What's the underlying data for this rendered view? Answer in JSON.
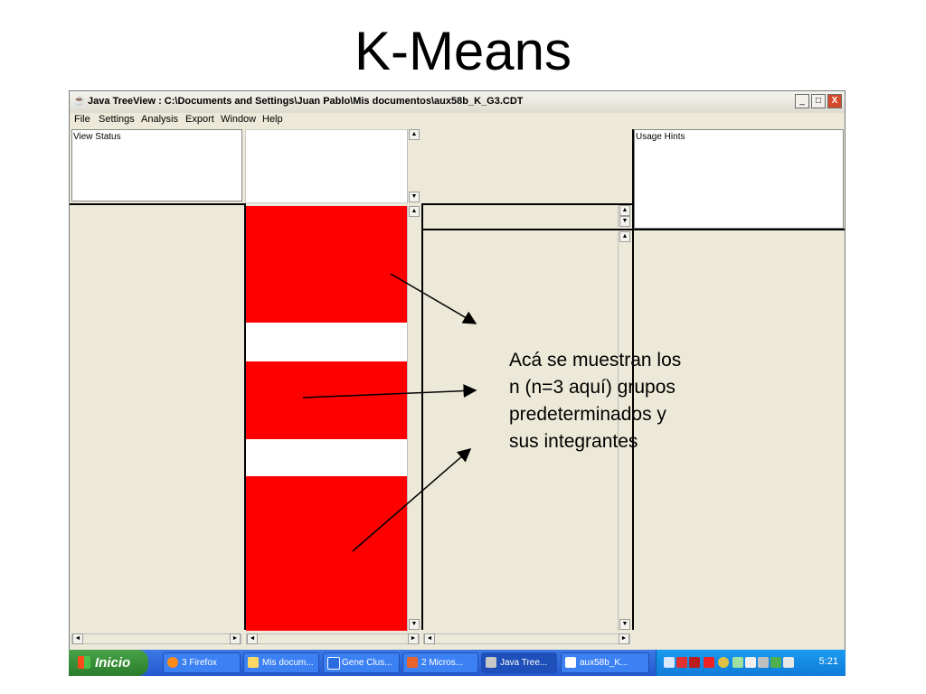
{
  "slide": {
    "title": "K-Means"
  },
  "window": {
    "title": "Java TreeView : C:\\Documents and Settings\\Juan Pablo\\Mis documentos\\aux58b_K_G3.CDT",
    "buttons": {
      "minimize": "_",
      "maximize": "□",
      "close": "X"
    }
  },
  "menu": [
    "File",
    "Settings",
    "Analysis",
    "Export",
    "Window",
    "Help"
  ],
  "panels": {
    "view_status": "View Status",
    "usage_hints": "Usage Hints"
  },
  "scroll_glyphs": {
    "up": "▲",
    "down": "▼",
    "left": "◄",
    "right": "►"
  },
  "annotation": {
    "lines": [
      "Acá se muestran los",
      "n (n=3 aquí) grupos",
      "predeterminados y",
      "sus integrantes"
    ]
  },
  "taskbar": {
    "start_label": "Inicio",
    "tasks": [
      {
        "label": "3 Firefox"
      },
      {
        "label": "Mis docum..."
      },
      {
        "label": "Gene Clus..."
      },
      {
        "label": "2 Micros..."
      },
      {
        "label": "Java Tree..."
      },
      {
        "label": "aux58b_K..."
      }
    ],
    "clock": "5:21"
  },
  "colors": {
    "cluster_fill": "#ff0000",
    "taskbar": "#2459cf",
    "start": "#2b7c2b"
  }
}
